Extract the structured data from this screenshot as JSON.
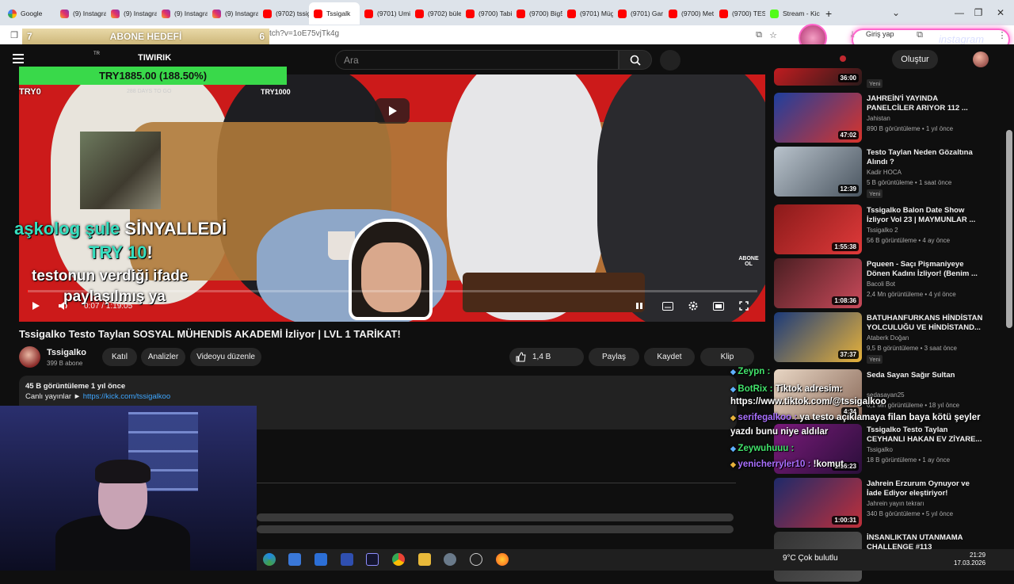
{
  "browser": {
    "tabs": [
      {
        "label": "Google",
        "icon": "google"
      },
      {
        "label": "(9) Instagra",
        "icon": "instagram"
      },
      {
        "label": "(9) Instagra",
        "icon": "instagram"
      },
      {
        "label": "(9) Instagra",
        "icon": "instagram"
      },
      {
        "label": "(9) Instagra",
        "icon": "instagram"
      },
      {
        "label": "(9702) tssig",
        "icon": "youtube"
      },
      {
        "label": "Tssigalk",
        "icon": "youtube",
        "active": true
      },
      {
        "label": "(9701) Umi",
        "icon": "youtube"
      },
      {
        "label": "(9702) büle",
        "icon": "youtube"
      },
      {
        "label": "(9700) Tabi",
        "icon": "youtube"
      },
      {
        "label": "(9700) Big5",
        "icon": "youtube"
      },
      {
        "label": "(9701) Müg",
        "icon": "youtube"
      },
      {
        "label": "(9701) Gar",
        "icon": "youtube"
      },
      {
        "label": "(9700) Met",
        "icon": "youtube"
      },
      {
        "label": "(9700) TEST",
        "icon": "youtube"
      },
      {
        "label": "Stream - Kic",
        "icon": "kick"
      }
    ],
    "url_fragment": "tch?v=1oE75vjTk4g",
    "login_label": "Giriş yap",
    "instagram_text": "instagram"
  },
  "abone_hedefi": {
    "current": "7",
    "label": "ABONE HEDEFİ",
    "target": "6"
  },
  "youtube": {
    "search_placeholder": "Ara",
    "create_label": "Oluştur"
  },
  "tiwirik": {
    "region": "TR",
    "title": "TIWIRIK",
    "bar_text": "TRY1885.00 (188.50%)",
    "min_label": "TRY0",
    "days_left": "288 DAYS TO GO",
    "max_label": "TRY1000"
  },
  "player": {
    "overlay_line1_a": "aşkolog şule",
    "overlay_line1_b": "SİNYALLEDİ",
    "overlay_line2": "TRY 10",
    "overlay_line2_b": "!",
    "overlay_line3": "testonun verdiği ifade",
    "overlay_line4": "paylaşılmış ya",
    "time": "0:07 / 1:19:05",
    "abone_ol": "ABONE OL",
    "progress_fraction": 0.0015
  },
  "video": {
    "title": "Tssigalko Testo Taylan SOSYAL MÜHENDİS AKADEMİ İzliyor | LVL 1 TARİKAT!",
    "channel": "Tssigalko",
    "subs": "399 B abone",
    "btn_join": "Katıl",
    "btn_analytics": "Analizler",
    "btn_edit": "Videoyu düzenle",
    "likes": "1,4 B",
    "btn_share": "Paylaş",
    "btn_save": "Kaydet",
    "btn_clip": "Klip",
    "views": "45 B görüntüleme  1 yıl önce",
    "live_label": "Canlı yayınlar ►",
    "live_link": "https://kick.com/tssigalkoo"
  },
  "sidebar": [
    {
      "title": "",
      "channel": "",
      "meta": "",
      "badge": "Yeni",
      "duration": "36:00",
      "color_a": "#c01c20",
      "color_b": "#2a1a1a"
    },
    {
      "title": "JAHREİN'İ YAYINDA PANELCİLER ARIYOR 112 ...",
      "channel": "Jahistan",
      "meta": "890 B görüntüleme • 1 yıl önce",
      "badge": "",
      "duration": "47:02",
      "color_a": "#1e3f9e",
      "color_b": "#d9342b"
    },
    {
      "title": "Testo  Taylan Neden Gözaltına Alındı ?",
      "channel": "Kadir HOCA",
      "meta": "5 B görüntüleme • 1 saat önce",
      "badge": "Yeni",
      "duration": "12:39",
      "color_a": "#b9c3cc",
      "color_b": "#4a5560"
    },
    {
      "title": "Tssigalko Balon Date Show İzliyor Vol 23 | MAYMUNLAR ...",
      "channel": "Tssigalko 2",
      "meta": "56 B görüntüleme • 4 ay önce",
      "badge": "",
      "duration": "1:55:38",
      "color_a": "#8a1a1a",
      "color_b": "#e03a3a"
    },
    {
      "title": "Pqueen - Saçı Pişmaniyeye Dönen Kadını İzliyor! (Benim ...",
      "channel": "Bacoli Bot",
      "meta": "2,4 Mn görüntüleme • 4 yıl önce",
      "badge": "",
      "duration": "1:08:36",
      "color_a": "#4a1e22",
      "color_b": "#c94a5a"
    },
    {
      "title": "BATUHANFURKANS HİNDİSTAN YOLCULUĞU VE HİNDİSTAND...",
      "channel": "Ataberk Doğan",
      "meta": "9,5 B görüntüleme • 3 saat önce",
      "badge": "Yeni",
      "duration": "37:37",
      "color_a": "#1b3a7a",
      "color_b": "#e7b23a"
    },
    {
      "title": "Seda Sayan    Sağır Sultan",
      "channel": "sedasayan25",
      "meta": "6,1 Mn görüntüleme • 18 yıl önce",
      "badge": "",
      "duration": "4:34",
      "color_a": "#e8d6c4",
      "color_b": "#8a6a5a"
    },
    {
      "title": "Tssigalko Testo Taylan CEYHANLI HAKAN EV ZİYARE...",
      "channel": "Tssigalko",
      "meta": "18 B görüntüleme • 1 ay önce",
      "badge": "",
      "duration": "1:16:23",
      "color_a": "#7a1a7a",
      "color_b": "#2a0f3a"
    },
    {
      "title": "Jahrein Erzurum Oynuyor ve İade Ediyor eleştiriyor!",
      "channel": "Jahrein yayın tekrarı",
      "meta": "340 B görüntüleme • 5 yıl önce",
      "badge": "",
      "duration": "1:00:31",
      "color_a": "#1e2a6a",
      "color_b": "#c0303a"
    },
    {
      "title": "İNSANLIKTAN UTANMAMA CHALLENGE #113",
      "channel": "",
      "meta": "",
      "badge": "",
      "duration": "",
      "color_a": "#333",
      "color_b": "#555"
    }
  ],
  "chat": [
    {
      "user": "Zeypn :",
      "msg": "",
      "color": "green"
    },
    {
      "user": "BotRix :",
      "msg": " Tiktok adresim:",
      "color": "green"
    },
    {
      "user": "",
      "msg": "https://www.tiktok.com/@tssigalkoo",
      "color": "green"
    },
    {
      "user": "serifegalkoo :",
      "msg": " ya testo açıklamaya filan baya kötü şeyler",
      "color": "purple"
    },
    {
      "user": "",
      "msg": "yazdı bunu niye aldılar",
      "color": "purple"
    },
    {
      "user": "Zeywuhuuu :",
      "msg": "",
      "color": "green"
    },
    {
      "user": "yenicherryler10 :",
      "msg": " !komut",
      "color": "purple"
    }
  ],
  "taskbar": {
    "weather": "9°C  Çok bulutlu",
    "time": "21:29",
    "date": "17.03.2026"
  }
}
